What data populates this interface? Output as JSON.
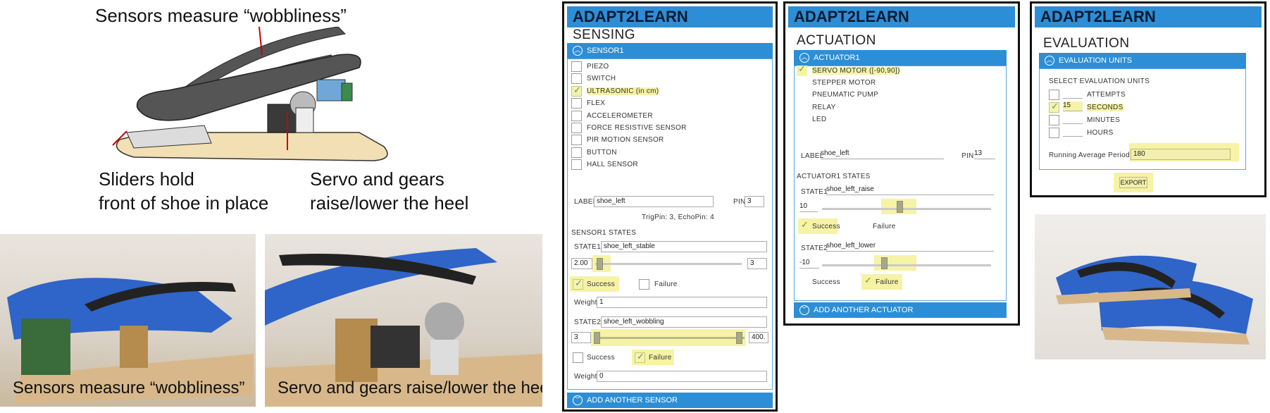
{
  "illustration": {
    "captions": {
      "sensors": "Sensors measure “wobbliness”",
      "sliders_line1": "Sliders hold",
      "sliders_line2": "front of shoe in place",
      "servo_line1": "Servo and gears",
      "servo_line2": "raise/lower the heel"
    }
  },
  "photos": {
    "left_caption": "Sensors measure “wobbliness”",
    "right_caption": "Servo and gears  raise/lower the heel"
  },
  "app_title": "ADAPT2LEARN",
  "sensing": {
    "section": "SENSING",
    "bar": "SENSOR1",
    "sensors": [
      {
        "label": "PIEZO",
        "checked": false
      },
      {
        "label": "SWITCH",
        "checked": false
      },
      {
        "label": "ULTRASONIC (in cm)",
        "checked": true
      },
      {
        "label": "FLEX",
        "checked": false
      },
      {
        "label": "ACCELEROMETER",
        "checked": false
      },
      {
        "label": "FORCE RESISTIVE SENSOR",
        "checked": false
      },
      {
        "label": "PIR MOTION SENSOR",
        "checked": false
      },
      {
        "label": "BUTTON",
        "checked": false
      },
      {
        "label": "HALL SENSOR",
        "checked": false
      }
    ],
    "label_caption": "LABEL",
    "label_value": "shoe_left",
    "pin_caption": "PIN",
    "pin_value": "3",
    "trig_echo": "TrigPin: 3, EchoPin: 4",
    "states_header": "SENSOR1 STATES",
    "state1": {
      "caption": "STATE1",
      "name": "shoe_left_stable",
      "min": "2.00",
      "max": "3",
      "success": "Success",
      "failure": "Failure",
      "success_checked": true,
      "failure_checked": false,
      "weight_caption": "Weight",
      "weight": "1"
    },
    "state2": {
      "caption": "STATE2",
      "name": "shoe_left_wobbling",
      "min": "3",
      "max": "400.",
      "success": "Success",
      "failure": "Failure",
      "success_checked": false,
      "failure_checked": true,
      "weight_caption": "Weight",
      "weight": "0"
    },
    "add": "ADD ANOTHER SENSOR"
  },
  "actuation": {
    "section": "ACTUATION",
    "bar": "ACTUATOR1",
    "actuators": [
      {
        "label": "SERVO MOTOR ([-90,90])",
        "checked": true
      },
      {
        "label": "STEPPER MOTOR",
        "checked": false
      },
      {
        "label": "PNEUMATIC PUMP",
        "checked": false
      },
      {
        "label": "RELAY",
        "checked": false
      },
      {
        "label": "LED",
        "checked": false
      }
    ],
    "label_caption": "LABEL",
    "label_value": "shoe_left",
    "pin_caption": "PIN",
    "pin_value": "13",
    "states_header": "ACTUATOR1 STATES",
    "state1": {
      "caption": "STATE1",
      "name": "shoe_left_raise",
      "value": "10",
      "success": "Success",
      "failure": "Failure"
    },
    "state2": {
      "caption": "STATE2",
      "name": "shoe_left_lower",
      "value": "-10",
      "success": "Success",
      "failure": "Failure"
    },
    "add": "ADD ANOTHER ACTUATOR"
  },
  "evaluation": {
    "section": "EVALUATION",
    "bar": "EVALUATION UNITS",
    "select_caption": "SELECT EVALUATION UNITS",
    "units": [
      {
        "label": "ATTEMPTS",
        "value": "",
        "checked": false
      },
      {
        "label": "SECONDS",
        "value": "15",
        "checked": true
      },
      {
        "label": "MINUTES",
        "value": "",
        "checked": false
      },
      {
        "label": "HOURS",
        "value": "",
        "checked": false
      }
    ],
    "running_caption": "Running Average Period",
    "running_value": "180",
    "export": "EXPORT"
  },
  "colors": {
    "accent": "#2c8ed6",
    "highlight": "#f6f3a6",
    "strap": "#3a3a3a",
    "tape": "#2f64c8"
  }
}
